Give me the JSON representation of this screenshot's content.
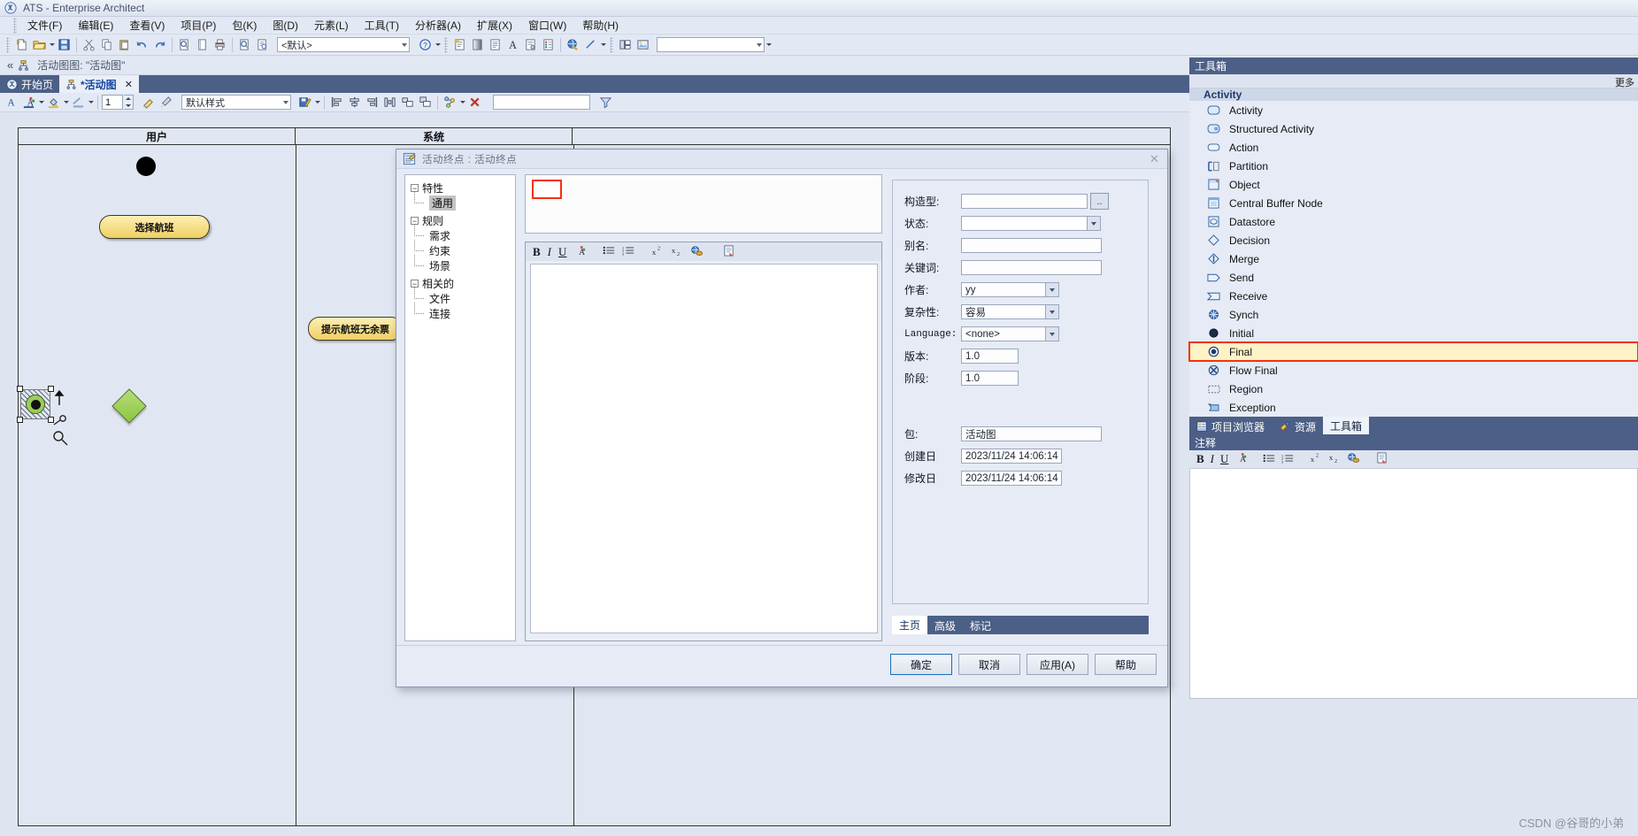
{
  "window": {
    "title": "ATS - Enterprise Architect",
    "app_icon": "ea-logo-icon"
  },
  "menubar": {
    "items": [
      {
        "label": "文件(F)"
      },
      {
        "label": "编辑(E)"
      },
      {
        "label": "查看(V)"
      },
      {
        "label": "项目(P)"
      },
      {
        "label": "包(K)"
      },
      {
        "label": "图(D)"
      },
      {
        "label": "元素(L)"
      },
      {
        "label": "工具(T)"
      },
      {
        "label": "分析器(A)"
      },
      {
        "label": "扩展(X)"
      },
      {
        "label": "窗口(W)"
      },
      {
        "label": "帮助(H)"
      }
    ]
  },
  "toolbar": {
    "style_combo_value": "<默认>",
    "icons": [
      "new-file-icon",
      "open-folder-icon",
      "save-icon",
      "cut-icon",
      "copy-icon",
      "paste-icon",
      "undo-icon",
      "redo-icon",
      "print-preview-icon",
      "page-icon",
      "print-icon",
      "zoom-find-icon",
      "inspect-icon",
      "help-icon",
      "checklist-icon",
      "gradient-icon",
      "document-icon",
      "font-icon",
      "properties-icon",
      "legend-icon",
      "globe-icon",
      "line-icon",
      "layout-icon",
      "image-icon"
    ]
  },
  "document_header": {
    "label": "活动图图: \"活动图\"",
    "left_icons": [
      "collapse-left-icon",
      "diagram-icon"
    ],
    "right_icons": [
      "pin-up-icon",
      "dropdown-icon",
      "close-icon"
    ]
  },
  "tabs": {
    "items": [
      {
        "label": "开始页",
        "active": false,
        "icon": "ea-start-icon"
      },
      {
        "label": "*活动图",
        "active": true,
        "icon": "activity-diagram-icon",
        "closable": true
      }
    ],
    "nav": [
      "prev-tab-icon",
      "next-tab-icon"
    ]
  },
  "diagram_toolbar": {
    "zoom_value": "1",
    "style_value": "默认样式",
    "icons": [
      "text-color-icon",
      "font-style-icon",
      "fill-color-icon",
      "line-color-icon",
      "format-painter-icon",
      "eyedropper-icon",
      "save-style-icon",
      "align-left-icon",
      "align-center-icon",
      "align-right-icon",
      "distribute-icon",
      "same-size-icon",
      "layout-icon",
      "autolayout-icon",
      "delete-icon"
    ],
    "filter_placeholder": "",
    "filter_icon": "filter-icon"
  },
  "canvas": {
    "lanes": [
      {
        "name": "用户"
      },
      {
        "name": "系统"
      },
      {
        "name": ""
      }
    ],
    "nodes": [
      {
        "type": "initial",
        "name": "initial-node"
      },
      {
        "type": "action",
        "label": "选择航班"
      },
      {
        "type": "action",
        "label": "提示航班无余票"
      },
      {
        "type": "final",
        "name": "activity-final-node",
        "selected": true
      },
      {
        "type": "decision",
        "name": "decision-node"
      }
    ]
  },
  "dialog": {
    "title": "活动终点 : 活动终点",
    "icon": "properties-dialog-icon",
    "close_icon": "close-icon",
    "tree": [
      {
        "label": "特性",
        "level": 0,
        "expander": "-"
      },
      {
        "label": "通用",
        "level": 1,
        "selected": true
      },
      {
        "label": "规则",
        "level": 0,
        "expander": "-"
      },
      {
        "label": "需求",
        "level": 1
      },
      {
        "label": "约束",
        "level": 1
      },
      {
        "label": "场景",
        "level": 1
      },
      {
        "label": "相关的",
        "level": 0,
        "expander": "-"
      },
      {
        "label": "文件",
        "level": 1
      },
      {
        "label": "连接",
        "level": 1
      }
    ],
    "name_field_value": "",
    "notes_toolbar_icons": [
      "bold-icon",
      "italic-icon",
      "underline-icon",
      "text-color-icon",
      "bullet-list-icon",
      "numbered-list-icon",
      "superscript-icon",
      "subscript-icon",
      "hyperlink-icon",
      "insert-doc-icon"
    ],
    "notes_value": "",
    "fields": [
      {
        "label": "构造型:",
        "value": "",
        "control": "text-with-browse",
        "browse_label": ".."
      },
      {
        "label": "状态:",
        "value": "",
        "control": "combo"
      },
      {
        "label": "别名:",
        "value": "",
        "control": "text"
      },
      {
        "label": "关键词:",
        "value": "",
        "control": "text"
      },
      {
        "label": "作者:",
        "value": "yy",
        "control": "combo"
      },
      {
        "label": "复杂性:",
        "value": "容易",
        "control": "combo"
      },
      {
        "label": "Language:",
        "value": "<none>",
        "control": "combo",
        "mono": true
      },
      {
        "label": "版本:",
        "value": "1.0",
        "control": "text"
      },
      {
        "label": "阶段:",
        "value": "1.0",
        "control": "text"
      },
      {
        "label": "包:",
        "value": "活动图",
        "control": "text"
      },
      {
        "label": "创建日",
        "value": "2023/11/24 14:06:14",
        "control": "text"
      },
      {
        "label": "修改日",
        "value": "2023/11/24 14:06:14",
        "control": "text"
      }
    ],
    "sub_tabs": [
      {
        "label": "主页",
        "active": true
      },
      {
        "label": "高级",
        "active": false
      },
      {
        "label": "标记",
        "active": false
      }
    ],
    "buttons": [
      {
        "label": "确定",
        "default": true
      },
      {
        "label": "取消",
        "default": false
      },
      {
        "label": "应用(A)",
        "default": false
      },
      {
        "label": "帮助",
        "default": false
      }
    ]
  },
  "toolbox": {
    "title": "工具箱",
    "more_label": "更多",
    "group_label": "Activity",
    "items": [
      {
        "label": "Activity",
        "icon": "activity-icon"
      },
      {
        "label": "Structured Activity",
        "icon": "structured-activity-icon"
      },
      {
        "label": "Action",
        "icon": "action-icon"
      },
      {
        "label": "Partition",
        "icon": "partition-icon"
      },
      {
        "label": "Object",
        "icon": "object-icon"
      },
      {
        "label": "Central Buffer Node",
        "icon": "central-buffer-node-icon"
      },
      {
        "label": "Datastore",
        "icon": "datastore-icon"
      },
      {
        "label": "Decision",
        "icon": "decision-icon"
      },
      {
        "label": "Merge",
        "icon": "merge-icon"
      },
      {
        "label": "Send",
        "icon": "send-icon"
      },
      {
        "label": "Receive",
        "icon": "receive-icon"
      },
      {
        "label": "Synch",
        "icon": "synch-icon"
      },
      {
        "label": "Initial",
        "icon": "initial-icon"
      },
      {
        "label": "Final",
        "icon": "final-icon",
        "selected": true
      },
      {
        "label": "Flow Final",
        "icon": "flow-final-icon"
      },
      {
        "label": "Region",
        "icon": "region-icon"
      },
      {
        "label": "Exception",
        "icon": "exception-icon"
      }
    ],
    "tabs": [
      {
        "label": "项目浏览器",
        "icon": "project-browser-icon",
        "active": false
      },
      {
        "label": "资源",
        "icon": "resources-icon",
        "active": false
      },
      {
        "label": "工具箱",
        "icon": "toolbox-icon",
        "active": true
      }
    ]
  },
  "notes_panel": {
    "title": "注释",
    "toolbar_icons": [
      "bold-icon",
      "italic-icon",
      "underline-icon",
      "text-color-icon",
      "bullet-list-icon",
      "numbered-list-icon",
      "superscript-icon",
      "subscript-icon",
      "hyperlink-icon",
      "insert-doc-icon"
    ],
    "body_value": ""
  },
  "watermark": "CSDN @谷哥的小弟",
  "colors": {
    "accent": "#4c5f86",
    "selection": "#fdf3c6",
    "highlight_border": "#f5320b",
    "action_fill": "#f0cf64",
    "decision_fill": "#8cc63f"
  }
}
